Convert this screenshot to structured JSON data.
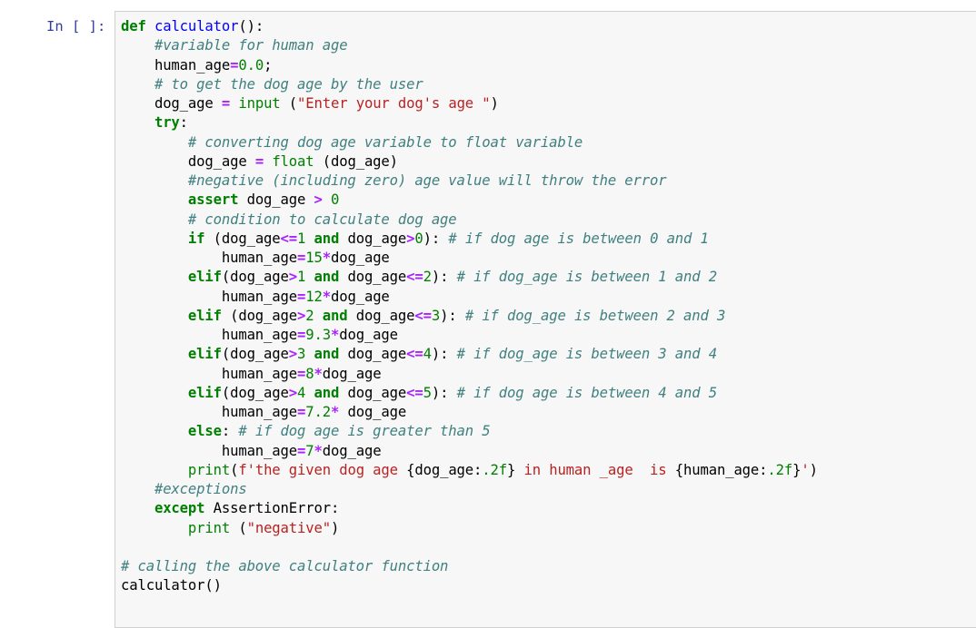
{
  "cell": {
    "prompt": "In [ ]:",
    "lines": [
      {
        "indent": 0,
        "tokens": [
          {
            "t": "kw",
            "v": "def"
          },
          {
            "t": "tx",
            "v": " "
          },
          {
            "t": "fn",
            "v": "calculator"
          },
          {
            "t": "tx",
            "v": "():"
          }
        ]
      },
      {
        "indent": 1,
        "tokens": [
          {
            "t": "cm",
            "v": "#variable for human age"
          }
        ]
      },
      {
        "indent": 1,
        "tokens": [
          {
            "t": "tx",
            "v": "human_age"
          },
          {
            "t": "op",
            "v": "="
          },
          {
            "t": "num",
            "v": "0.0"
          },
          {
            "t": "tx",
            "v": ";"
          }
        ]
      },
      {
        "indent": 1,
        "tokens": [
          {
            "t": "cm",
            "v": "# to get the dog age by the user"
          }
        ]
      },
      {
        "indent": 1,
        "tokens": [
          {
            "t": "tx",
            "v": "dog_age "
          },
          {
            "t": "op",
            "v": "="
          },
          {
            "t": "tx",
            "v": " "
          },
          {
            "t": "bi",
            "v": "input"
          },
          {
            "t": "tx",
            "v": " ("
          },
          {
            "t": "str",
            "v": "\"Enter your dog's age \""
          },
          {
            "t": "tx",
            "v": ")"
          }
        ]
      },
      {
        "indent": 1,
        "tokens": [
          {
            "t": "kw",
            "v": "try"
          },
          {
            "t": "tx",
            "v": ":"
          }
        ]
      },
      {
        "indent": 2,
        "tokens": [
          {
            "t": "cm",
            "v": "# converting dog age variable to float variable"
          }
        ]
      },
      {
        "indent": 2,
        "tokens": [
          {
            "t": "tx",
            "v": "dog_age "
          },
          {
            "t": "op",
            "v": "="
          },
          {
            "t": "tx",
            "v": " "
          },
          {
            "t": "bi",
            "v": "float"
          },
          {
            "t": "tx",
            "v": " (dog_age)"
          }
        ]
      },
      {
        "indent": 2,
        "tokens": [
          {
            "t": "cm",
            "v": "#negative (including zero) age value will throw the error"
          }
        ]
      },
      {
        "indent": 2,
        "tokens": [
          {
            "t": "kw",
            "v": "assert"
          },
          {
            "t": "tx",
            "v": " dog_age "
          },
          {
            "t": "op",
            "v": ">"
          },
          {
            "t": "tx",
            "v": " "
          },
          {
            "t": "num",
            "v": "0"
          }
        ]
      },
      {
        "indent": 2,
        "tokens": [
          {
            "t": "cm",
            "v": "# condition to calculate dog age"
          }
        ]
      },
      {
        "indent": 2,
        "tokens": [
          {
            "t": "kw",
            "v": "if"
          },
          {
            "t": "tx",
            "v": " (dog_age"
          },
          {
            "t": "op",
            "v": "<="
          },
          {
            "t": "num",
            "v": "1"
          },
          {
            "t": "tx",
            "v": " "
          },
          {
            "t": "kw",
            "v": "and"
          },
          {
            "t": "tx",
            "v": " dog_age"
          },
          {
            "t": "op",
            "v": ">"
          },
          {
            "t": "num",
            "v": "0"
          },
          {
            "t": "tx",
            "v": "): "
          },
          {
            "t": "cm",
            "v": "# if dog age is between 0 and 1"
          }
        ]
      },
      {
        "indent": 3,
        "tokens": [
          {
            "t": "tx",
            "v": "human_age"
          },
          {
            "t": "op",
            "v": "="
          },
          {
            "t": "num",
            "v": "15"
          },
          {
            "t": "op",
            "v": "*"
          },
          {
            "t": "tx",
            "v": "dog_age"
          }
        ]
      },
      {
        "indent": 2,
        "tokens": [
          {
            "t": "kw",
            "v": "elif"
          },
          {
            "t": "tx",
            "v": "(dog_age"
          },
          {
            "t": "op",
            "v": ">"
          },
          {
            "t": "num",
            "v": "1"
          },
          {
            "t": "tx",
            "v": " "
          },
          {
            "t": "kw",
            "v": "and"
          },
          {
            "t": "tx",
            "v": " dog_age"
          },
          {
            "t": "op",
            "v": "<="
          },
          {
            "t": "num",
            "v": "2"
          },
          {
            "t": "tx",
            "v": "): "
          },
          {
            "t": "cm",
            "v": "# if dog_age is between 1 and 2"
          }
        ]
      },
      {
        "indent": 3,
        "tokens": [
          {
            "t": "tx",
            "v": "human_age"
          },
          {
            "t": "op",
            "v": "="
          },
          {
            "t": "num",
            "v": "12"
          },
          {
            "t": "op",
            "v": "*"
          },
          {
            "t": "tx",
            "v": "dog_age"
          }
        ]
      },
      {
        "indent": 2,
        "tokens": [
          {
            "t": "kw",
            "v": "elif"
          },
          {
            "t": "tx",
            "v": " (dog_age"
          },
          {
            "t": "op",
            "v": ">"
          },
          {
            "t": "num",
            "v": "2"
          },
          {
            "t": "tx",
            "v": " "
          },
          {
            "t": "kw",
            "v": "and"
          },
          {
            "t": "tx",
            "v": " dog_age"
          },
          {
            "t": "op",
            "v": "<="
          },
          {
            "t": "num",
            "v": "3"
          },
          {
            "t": "tx",
            "v": "): "
          },
          {
            "t": "cm",
            "v": "# if dog_age is between 2 and 3"
          }
        ]
      },
      {
        "indent": 3,
        "tokens": [
          {
            "t": "tx",
            "v": "human_age"
          },
          {
            "t": "op",
            "v": "="
          },
          {
            "t": "num",
            "v": "9.3"
          },
          {
            "t": "op",
            "v": "*"
          },
          {
            "t": "tx",
            "v": "dog_age"
          }
        ]
      },
      {
        "indent": 2,
        "tokens": [
          {
            "t": "kw",
            "v": "elif"
          },
          {
            "t": "tx",
            "v": "(dog_age"
          },
          {
            "t": "op",
            "v": ">"
          },
          {
            "t": "num",
            "v": "3"
          },
          {
            "t": "tx",
            "v": " "
          },
          {
            "t": "kw",
            "v": "and"
          },
          {
            "t": "tx",
            "v": " dog_age"
          },
          {
            "t": "op",
            "v": "<="
          },
          {
            "t": "num",
            "v": "4"
          },
          {
            "t": "tx",
            "v": "): "
          },
          {
            "t": "cm",
            "v": "# if dog_age is between 3 and 4"
          }
        ]
      },
      {
        "indent": 3,
        "tokens": [
          {
            "t": "tx",
            "v": "human_age"
          },
          {
            "t": "op",
            "v": "="
          },
          {
            "t": "num",
            "v": "8"
          },
          {
            "t": "op",
            "v": "*"
          },
          {
            "t": "tx",
            "v": "dog_age"
          }
        ]
      },
      {
        "indent": 2,
        "tokens": [
          {
            "t": "kw",
            "v": "elif"
          },
          {
            "t": "tx",
            "v": "(dog_age"
          },
          {
            "t": "op",
            "v": ">"
          },
          {
            "t": "num",
            "v": "4"
          },
          {
            "t": "tx",
            "v": " "
          },
          {
            "t": "kw",
            "v": "and"
          },
          {
            "t": "tx",
            "v": " dog_age"
          },
          {
            "t": "op",
            "v": "<="
          },
          {
            "t": "num",
            "v": "5"
          },
          {
            "t": "tx",
            "v": "): "
          },
          {
            "t": "cm",
            "v": "# if dog age is between 4 and 5"
          }
        ]
      },
      {
        "indent": 3,
        "tokens": [
          {
            "t": "tx",
            "v": "human_age"
          },
          {
            "t": "op",
            "v": "="
          },
          {
            "t": "num",
            "v": "7.2"
          },
          {
            "t": "op",
            "v": "*"
          },
          {
            "t": "tx",
            "v": " dog_age"
          }
        ]
      },
      {
        "indent": 2,
        "tokens": [
          {
            "t": "kw",
            "v": "else"
          },
          {
            "t": "tx",
            "v": ": "
          },
          {
            "t": "cm",
            "v": "# if dog age is greater than 5"
          }
        ]
      },
      {
        "indent": 3,
        "tokens": [
          {
            "t": "tx",
            "v": "human_age"
          },
          {
            "t": "op",
            "v": "="
          },
          {
            "t": "num",
            "v": "7"
          },
          {
            "t": "op",
            "v": "*"
          },
          {
            "t": "tx",
            "v": "dog_age"
          }
        ]
      },
      {
        "indent": 2,
        "tokens": [
          {
            "t": "bi",
            "v": "print"
          },
          {
            "t": "tx",
            "v": "("
          },
          {
            "t": "str",
            "v": "f'the given dog age "
          },
          {
            "t": "si",
            "v": "{dog_age:"
          },
          {
            "t": "num",
            "v": ".2f"
          },
          {
            "t": "si",
            "v": "}"
          },
          {
            "t": "str",
            "v": " in human _age  is "
          },
          {
            "t": "si",
            "v": "{human_age:"
          },
          {
            "t": "num",
            "v": ".2f"
          },
          {
            "t": "si",
            "v": "}"
          },
          {
            "t": "str",
            "v": "'"
          },
          {
            "t": "tx",
            "v": ")"
          }
        ]
      },
      {
        "indent": 1,
        "tokens": [
          {
            "t": "cm",
            "v": "#exceptions"
          }
        ]
      },
      {
        "indent": 1,
        "tokens": [
          {
            "t": "kw",
            "v": "except"
          },
          {
            "t": "tx",
            "v": " AssertionError:"
          }
        ]
      },
      {
        "indent": 2,
        "tokens": [
          {
            "t": "bi",
            "v": "print"
          },
          {
            "t": "tx",
            "v": " ("
          },
          {
            "t": "str",
            "v": "\"negative\""
          },
          {
            "t": "tx",
            "v": ")"
          }
        ]
      },
      {
        "indent": 0,
        "tokens": []
      },
      {
        "indent": 0,
        "tokens": [
          {
            "t": "cm",
            "v": "# calling the above calculator function"
          }
        ]
      },
      {
        "indent": 0,
        "tokens": [
          {
            "t": "tx",
            "v": "calculator()"
          }
        ]
      }
    ]
  },
  "colors": {
    "prompt": "#303f9f",
    "keyword": "#008000",
    "function_name": "#0000ff",
    "comment": "#408080",
    "operator": "#aa22ff",
    "string": "#ba2121",
    "cell_background": "#f7f7f7",
    "cell_border": "#cfcfcf"
  }
}
